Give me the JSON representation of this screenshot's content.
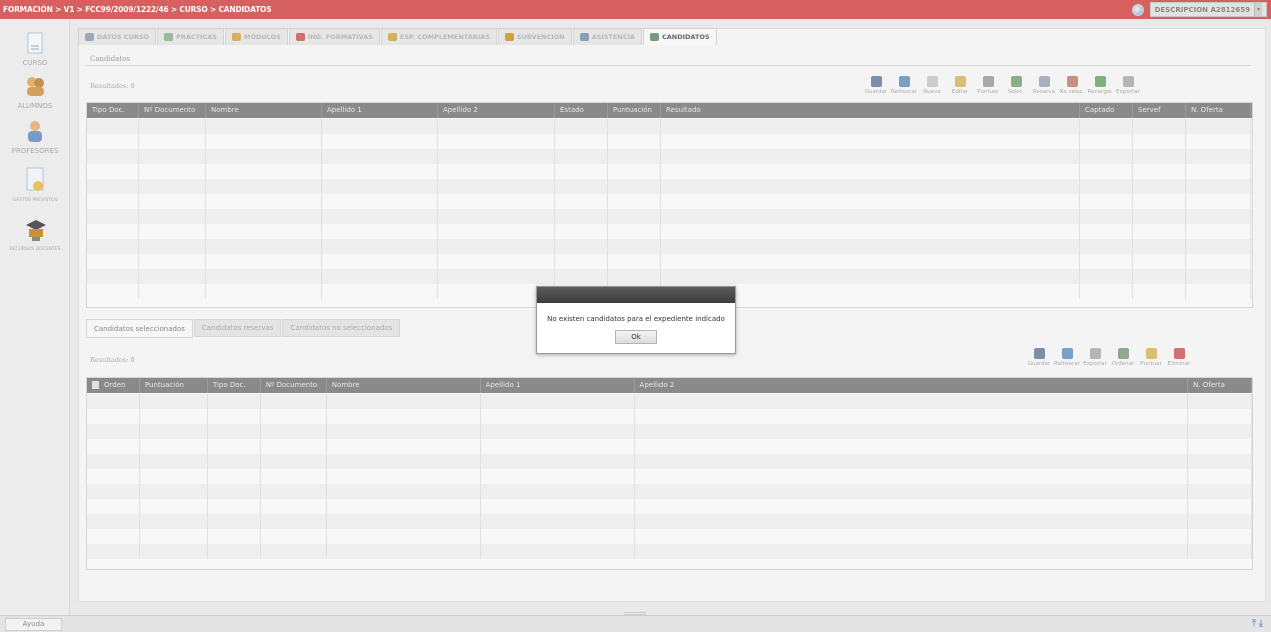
{
  "header": {
    "breadcrumb": "FORMACIÓN > V1 > FCC99/2009/1222/46 > CURSO > CANDIDATOS",
    "user_label": "DESCRIPCION A2812659"
  },
  "sidebar": {
    "items": [
      {
        "label": "CURSO",
        "icon": "document-icon"
      },
      {
        "label": "ALUMNOS",
        "icon": "students-icon"
      },
      {
        "label": "PROFESORES",
        "icon": "teacher-icon"
      },
      {
        "label": "GASTOS PREVISTOS",
        "icon": "expenses-icon"
      },
      {
        "label": "RECURSOS DOCENTES",
        "icon": "resources-icon"
      }
    ]
  },
  "tabs": [
    {
      "label": "DATOS CURSO",
      "color": "#9aa8b8"
    },
    {
      "label": "PRACTICAS",
      "color": "#9ab89a"
    },
    {
      "label": "MÓDULOS",
      "color": "#d6b060"
    },
    {
      "label": "IND. FORMATIVAS",
      "color": "#d07070"
    },
    {
      "label": "ESP. COMPLEMENTARIAS",
      "color": "#d4b060"
    },
    {
      "label": "SUBVENCION",
      "color": "#d4a040"
    },
    {
      "label": "ASISTENCIA",
      "color": "#8aa0b8"
    },
    {
      "label": "CANDIDATOS",
      "color": "#7a9a7a"
    }
  ],
  "top_section": {
    "subtitle": "Candidatos",
    "results": "Resultados: 0",
    "toolbar": [
      {
        "label": "Guardar",
        "icon": "save-icon",
        "color": "#7a8fa8"
      },
      {
        "label": "Refrescar",
        "icon": "refresh-icon",
        "color": "#7aa0c8"
      },
      {
        "label": "Nuevo",
        "icon": "new-icon",
        "color": "#cccccc"
      },
      {
        "label": "Editar",
        "icon": "edit-icon",
        "color": "#d8c070"
      },
      {
        "label": "Puntuar",
        "icon": "score-icon",
        "color": "#a8a8a8"
      },
      {
        "label": "Selec.",
        "icon": "select-icon",
        "color": "#8ab08a"
      },
      {
        "label": "Reserva",
        "icon": "reserve-icon",
        "color": "#a8b0c0"
      },
      {
        "label": "No selec.",
        "icon": "unselect-icon",
        "color": "#c89080"
      },
      {
        "label": "Recargar",
        "icon": "reload-icon",
        "color": "#80b080"
      },
      {
        "label": "Exportar",
        "icon": "export-icon",
        "color": "#b0b8b0"
      }
    ],
    "columns": [
      "Tipo Doc.",
      "Nº Documento",
      "Nombre",
      "Apellido 1",
      "Apellido 2",
      "Estado",
      "Puntuación",
      "Resultado",
      "Captado",
      "Servef",
      "N. Oferta"
    ]
  },
  "bottom_section": {
    "tabs": [
      "Candidatos seleccionados",
      "Candidatos reservas",
      "Candidatos no seleccionados"
    ],
    "results": "Resultados: 0",
    "toolbar": [
      {
        "label": "Guardar",
        "icon": "save-icon",
        "color": "#7a8fa8"
      },
      {
        "label": "Refrescar",
        "icon": "refresh-icon",
        "color": "#7aa0c8"
      },
      {
        "label": "Exportar",
        "icon": "export-icon",
        "color": "#b0b8b0"
      },
      {
        "label": "Ordenar",
        "icon": "sort-icon",
        "color": "#90a890"
      },
      {
        "label": "Puntuar",
        "icon": "score-icon",
        "color": "#d8c070"
      },
      {
        "label": "Eliminar",
        "icon": "delete-icon",
        "color": "#d07070"
      }
    ],
    "columns": [
      "Orden",
      "Puntuación",
      "Tipo Doc.",
      "Nº Documento",
      "Nombre",
      "Apellido 1",
      "Apellido 2",
      "N. Oferta"
    ]
  },
  "dialog": {
    "message": "No existen candidatos para el expediente indicado",
    "ok_label": "Ok"
  },
  "footer": {
    "help_label": "Ayuda"
  }
}
